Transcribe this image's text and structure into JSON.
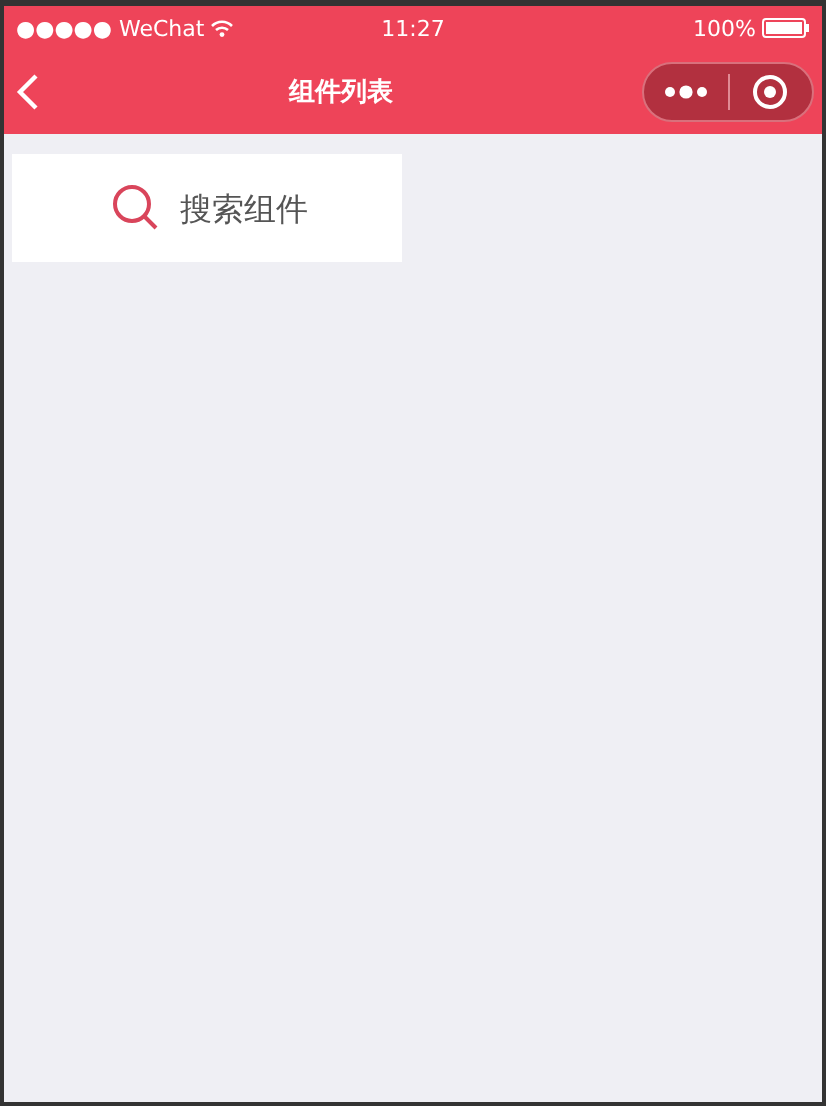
{
  "status_bar": {
    "carrier": "●●●●● WeChat",
    "time": "11:27",
    "battery": "100%"
  },
  "nav_bar": {
    "title": "组件列表"
  },
  "search": {
    "placeholder": "搜索组件"
  }
}
